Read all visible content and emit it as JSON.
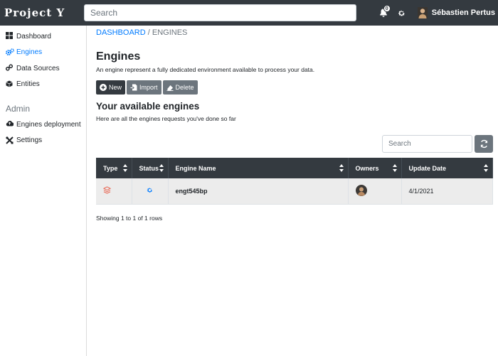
{
  "app": {
    "brand": "Project Y"
  },
  "topbar": {
    "search_placeholder": "Search",
    "notification_count": "0",
    "user_name": "Sébastien Pertus"
  },
  "sidebar": {
    "items": [
      {
        "label": "Dashboard",
        "icon": "grid-icon"
      },
      {
        "label": "Engines",
        "icon": "cogs-icon",
        "active": true
      },
      {
        "label": "Data Sources",
        "icon": "link-icon"
      },
      {
        "label": "Entities",
        "icon": "cube-icon"
      }
    ],
    "admin_heading": "Admin",
    "admin_items": [
      {
        "label": "Engines deployment",
        "icon": "cloud-upload-icon"
      },
      {
        "label": "Settings",
        "icon": "tools-icon"
      }
    ]
  },
  "breadcrumb": {
    "root": "DASHBOARD",
    "separator": "/",
    "current": "ENGINES"
  },
  "page": {
    "title": "Engines",
    "description": "An engine represent a fully dedicated environment available to process your data."
  },
  "actions": {
    "new_label": "New",
    "import_label": "Import",
    "delete_label": "Delete"
  },
  "section": {
    "title": "Your available engines",
    "description": "Here are all the engines requests you've done so far"
  },
  "table": {
    "search_placeholder": "Search",
    "columns": [
      "Type",
      "Status",
      "Engine Name",
      "Owners",
      "Update Date"
    ],
    "rows": [
      {
        "type_icon": "layers-icon",
        "status_icon": "gear-icon",
        "name": "engt545bp",
        "owner_icon": "avatar",
        "update_date": "4/1/2021"
      }
    ],
    "pagination_info": "Showing 1 to 1 of 1 rows"
  },
  "colors": {
    "topbar": "#343a40",
    "accent": "#007bff",
    "type_icon": "#e8604c",
    "button_gray": "#6c757d"
  }
}
